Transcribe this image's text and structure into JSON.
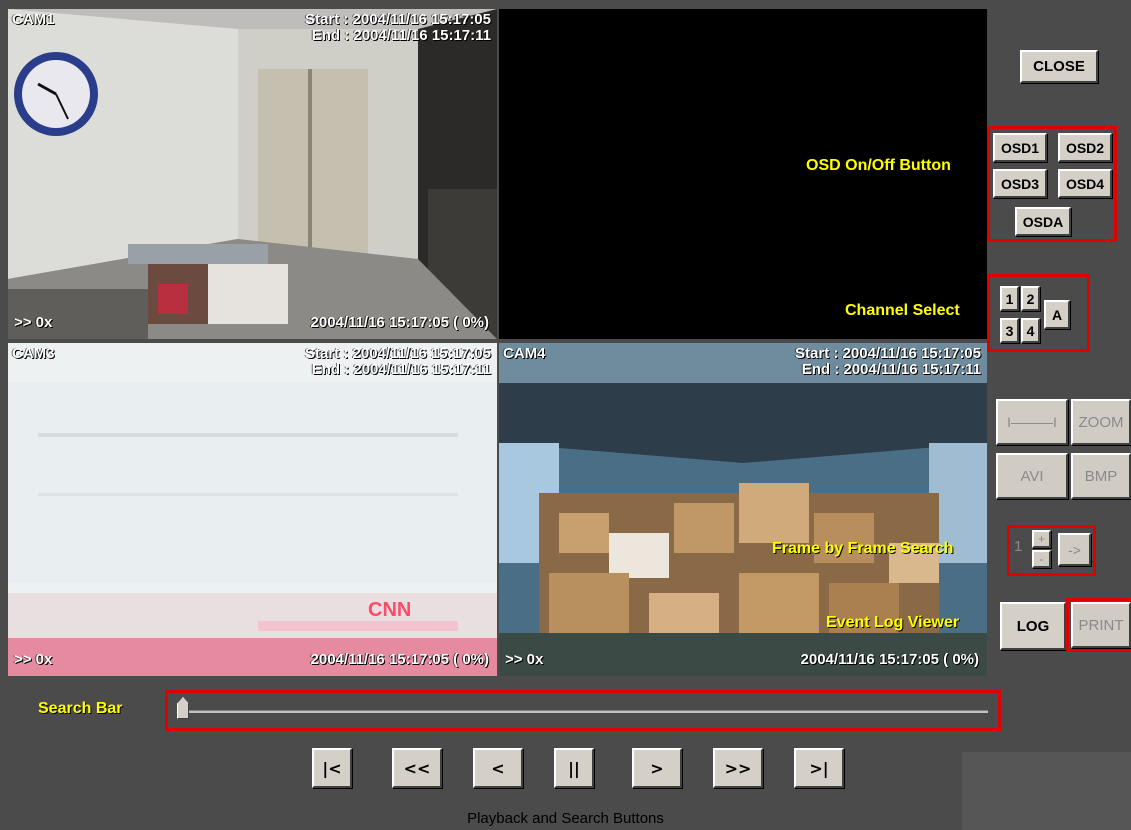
{
  "cameras": [
    {
      "label": "CAM1",
      "start": "Start : 2004/11/16 15:17:05",
      "end": "End  : 2004/11/16 15:17:11",
      "speed": ">> 0x",
      "stamp": "2004/11/16 15:17:05 ( 0%)"
    },
    {
      "label": "",
      "start": "",
      "end": "",
      "speed": "",
      "stamp": ""
    },
    {
      "label": "CAM3",
      "start": "Start : 2004/11/16 15:17:05",
      "end": "End  : 2004/11/16 15:17:11",
      "speed": ">> 0x",
      "stamp": "2004/11/16 15:17:05 ( 0%)"
    },
    {
      "label": "CAM4",
      "start": "Start : 2004/11/16 15:17:05",
      "end": "End  : 2004/11/16 15:17:11",
      "speed": ">> 0x",
      "stamp": "2004/11/16 15:17:05 ( 0%)"
    }
  ],
  "overlay_logo": "CNN",
  "controls": {
    "close": "CLOSE",
    "osd": [
      "OSD1",
      "OSD2",
      "OSD3",
      "OSD4",
      "OSDA"
    ],
    "channels": [
      "1",
      "2",
      "3",
      "4",
      "A"
    ],
    "zoom_slider": "I———I",
    "zoom": "ZOOM",
    "avi": "AVI",
    "bmp": "BMP",
    "frame_value": "1",
    "frame_up": "+",
    "frame_down": "-",
    "frame_go": "->",
    "log": "LOG",
    "print": "PRINT"
  },
  "annotations": {
    "osd": "OSD On/Off Button",
    "channel": "Channel Select",
    "frame": "Frame by Frame Search",
    "log": "Event Log Viewer",
    "search": "Search Bar",
    "playback": "Playback and Search Buttons"
  },
  "search_bar": {
    "position": 0
  },
  "playback": [
    "|<",
    "<<",
    "<",
    "||",
    ">",
    ">>",
    ">|"
  ],
  "icons": [
    "first-frame-icon",
    "fast-rewind-icon",
    "step-back-icon",
    "pause-icon",
    "play-icon",
    "fast-forward-icon",
    "last-frame-icon"
  ],
  "colors": {
    "annotation": "#ffff00",
    "highlight_box": "#e00000",
    "panel": "#4b4b4b",
    "button": "#d4d0c8"
  }
}
